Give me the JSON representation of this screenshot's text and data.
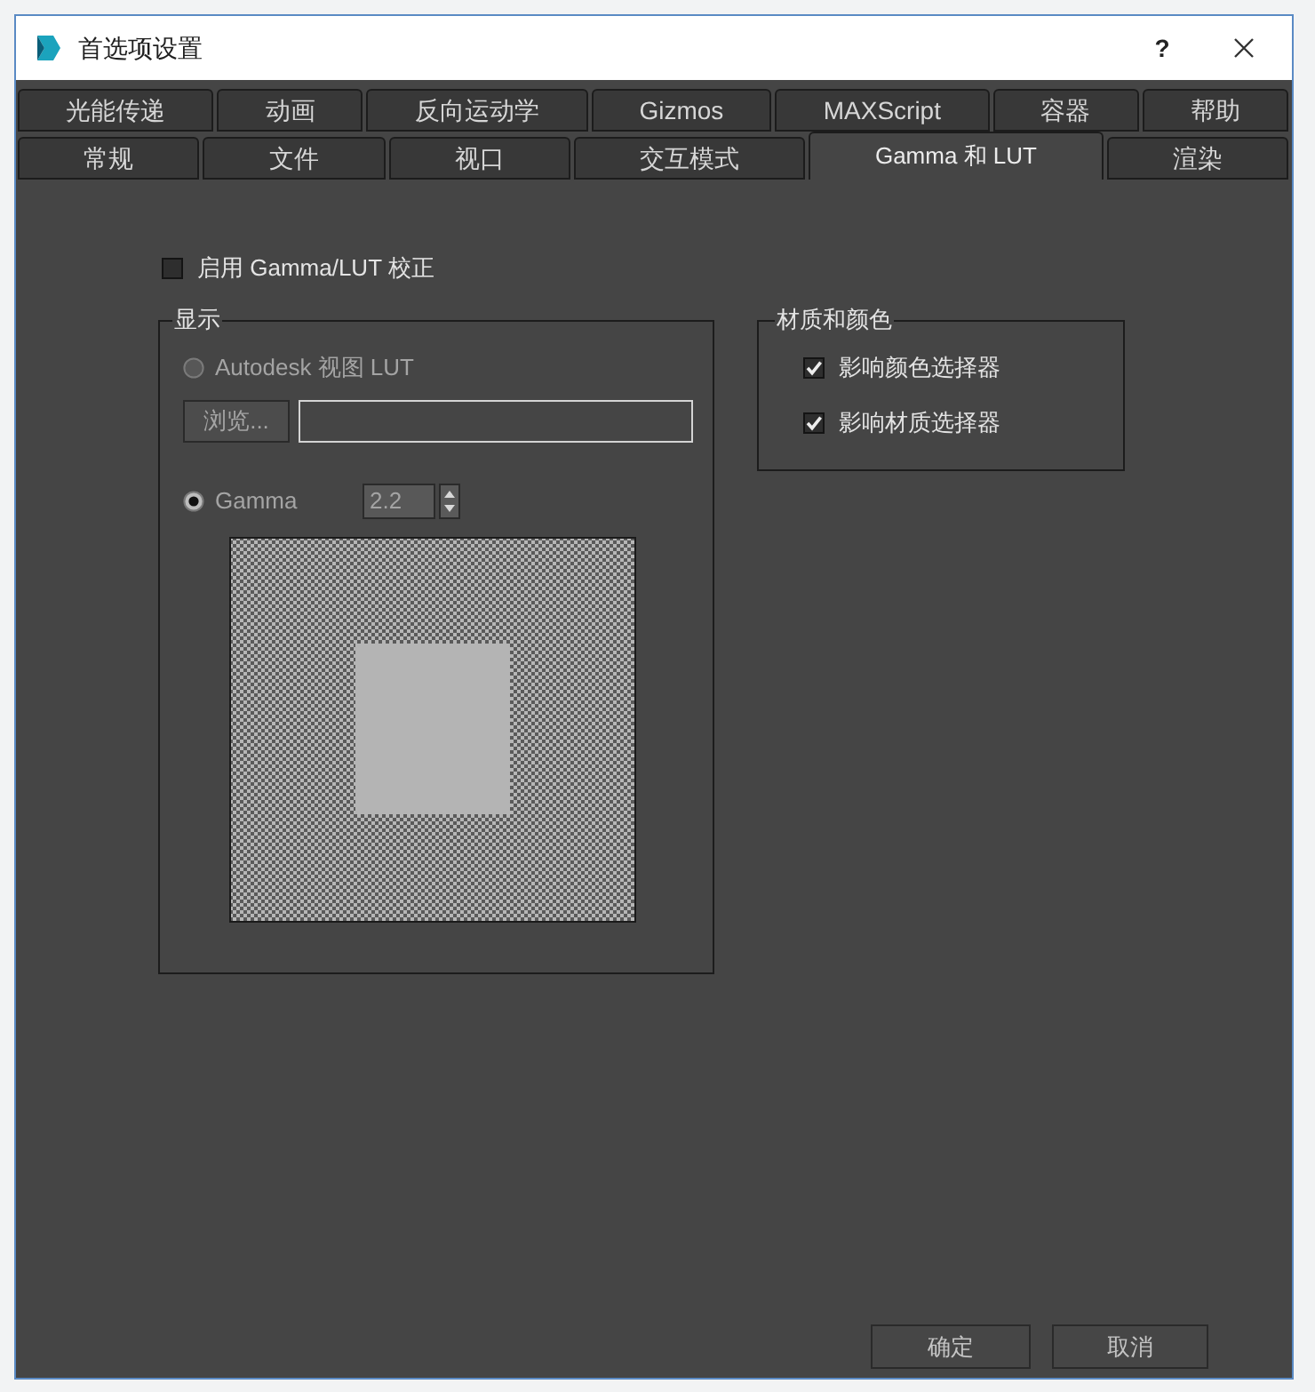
{
  "window": {
    "title": "首选项设置",
    "help_button": "?"
  },
  "tab_rows": [
    {
      "tabs": [
        {
          "label": "光能传递",
          "selected": false
        },
        {
          "label": "动画",
          "selected": false
        },
        {
          "label": "反向运动学",
          "selected": false
        },
        {
          "label": "Gizmos",
          "selected": false
        },
        {
          "label": "MAXScript",
          "selected": false
        },
        {
          "label": "容器",
          "selected": false
        },
        {
          "label": "帮助",
          "selected": false
        }
      ]
    },
    {
      "tabs": [
        {
          "label": "常规",
          "selected": false
        },
        {
          "label": "文件",
          "selected": false
        },
        {
          "label": "视口",
          "selected": false
        },
        {
          "label": "交互模式",
          "selected": false
        },
        {
          "label": "Gamma 和 LUT",
          "selected": true
        },
        {
          "label": "渲染",
          "selected": false
        }
      ]
    }
  ],
  "enable_correction": {
    "label": "启用 Gamma/LUT 校正",
    "checked": false
  },
  "display_group": {
    "title": "显示",
    "lut_option": {
      "label": "Autodesk 视图 LUT",
      "selected": false,
      "disabled": true
    },
    "browse_button": {
      "label": "浏览...",
      "disabled": true
    },
    "gamma_option": {
      "label": "Gamma",
      "selected": true,
      "disabled": true
    },
    "gamma_value": {
      "value": "2.2",
      "disabled": true
    }
  },
  "material_group": {
    "title": "材质和颜色",
    "options": [
      {
        "label": "影响颜色选择器",
        "checked": true
      },
      {
        "label": "影响材质选择器",
        "checked": true
      }
    ]
  },
  "buttons": [
    {
      "label": "确定"
    },
    {
      "label": "取消"
    }
  ]
}
